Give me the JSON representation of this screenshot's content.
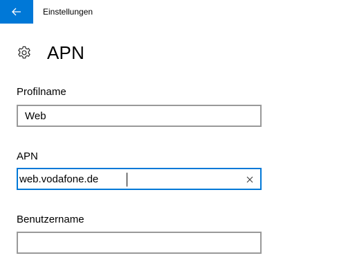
{
  "window": {
    "title": "Einstellungen",
    "accent_color": "#0078d7",
    "back_icon": "arrow-left-icon"
  },
  "header": {
    "icon": "gear-icon",
    "title": "APN"
  },
  "form": {
    "profile_name": {
      "label": "Profilname",
      "value": "Web"
    },
    "apn": {
      "label": "APN",
      "value": "web.vodafone.de",
      "clear_icon": "close-icon"
    },
    "username": {
      "label": "Benutzername",
      "value": ""
    }
  }
}
